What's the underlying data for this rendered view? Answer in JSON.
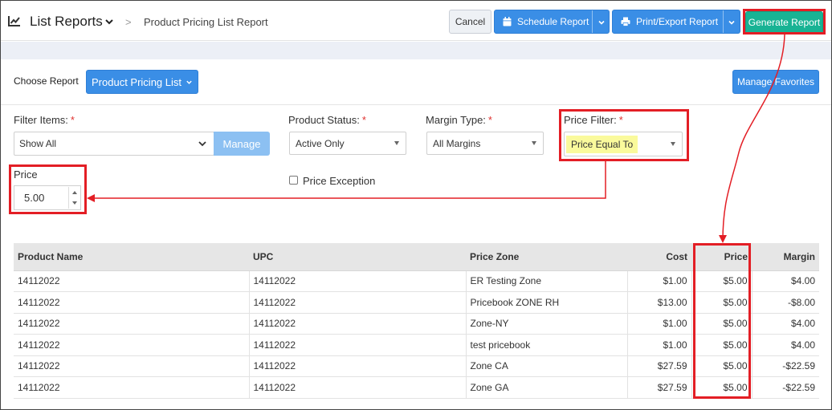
{
  "header": {
    "title": "List Reports",
    "breadcrumb_sep": ">",
    "breadcrumb": "Product Pricing List Report",
    "cancel_label": "Cancel",
    "schedule_label": "Schedule Report",
    "print_label": "Print/Export Report",
    "generate_label": "Generate Report"
  },
  "choose": {
    "label": "Choose Report",
    "selected": "Product Pricing List",
    "favorites_label": "Manage Favorites"
  },
  "filters": {
    "filter_items_label": "Filter Items:",
    "filter_items_value": "Show All",
    "manage_label": "Manage",
    "product_status_label": "Product Status:",
    "product_status_value": "Active Only",
    "margin_type_label": "Margin Type:",
    "margin_type_value": "All Margins",
    "price_filter_label": "Price Filter:",
    "price_filter_value": "Price Equal To",
    "required_mark": "*",
    "price_label": "Price",
    "price_value": "5.00",
    "price_exception_label": "Price Exception"
  },
  "table": {
    "columns": [
      "Product Name",
      "UPC",
      "Price Zone",
      "Cost",
      "Price",
      "Margin"
    ],
    "rows": [
      [
        "14112022",
        "14112022",
        "ER Testing Zone",
        "$1.00",
        "$5.00",
        "$4.00"
      ],
      [
        "14112022",
        "14112022",
        "Pricebook ZONE RH",
        "$13.00",
        "$5.00",
        "-$8.00"
      ],
      [
        "14112022",
        "14112022",
        "Zone-NY",
        "$1.00",
        "$5.00",
        "$4.00"
      ],
      [
        "14112022",
        "14112022",
        "test pricebook",
        "$1.00",
        "$5.00",
        "$4.00"
      ],
      [
        "14112022",
        "14112022",
        "Zone CA",
        "$27.59",
        "$5.00",
        "-$22.59"
      ],
      [
        "14112022",
        "14112022",
        "Zone GA",
        "$27.59",
        "$5.00",
        "-$22.59"
      ]
    ]
  },
  "colors": {
    "primary": "#3a8ee6",
    "generate": "#18b394",
    "annotation": "#e31e25",
    "highlight": "#fafa9c"
  }
}
